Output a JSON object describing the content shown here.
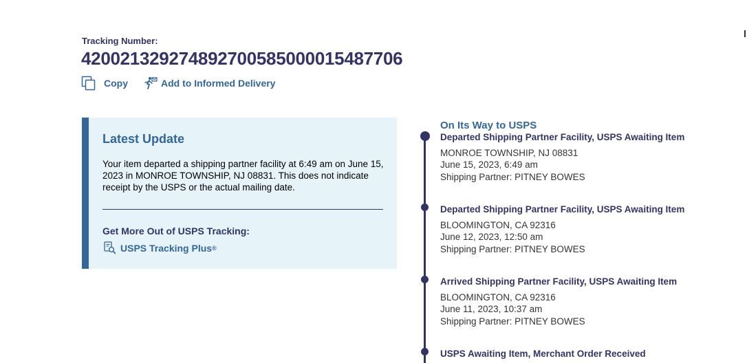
{
  "tracking": {
    "label": "Tracking Number:",
    "number": "420021329274892700585000015487706"
  },
  "actions": {
    "copy_label": "Copy",
    "informed_delivery_label": "Add to Informed Delivery"
  },
  "latest_update": {
    "title": "Latest Update",
    "text": "Your item departed a shipping partner facility at 6:49 am on June 15, 2023 in MONROE TOWNSHIP, NJ 08831. This does not indicate receipt by the USPS or the actual mailing date.",
    "more_title": "Get More Out of USPS Tracking:",
    "plus_label": "USPS Tracking Plus",
    "plus_mark": "®"
  },
  "timeline": {
    "status": "On Its Way to USPS",
    "events": [
      {
        "title": "Departed Shipping Partner Facility, USPS Awaiting Item",
        "location": "MONROE TOWNSHIP, NJ 08831",
        "datetime": "June 15, 2023, 6:49 am",
        "partner": "Shipping Partner: PITNEY BOWES"
      },
      {
        "title": "Departed Shipping Partner Facility, USPS Awaiting Item",
        "location": "BLOOMINGTON, CA 92316",
        "datetime": "June 12, 2023, 12:50 am",
        "partner": "Shipping Partner: PITNEY BOWES"
      },
      {
        "title": "Arrived Shipping Partner Facility, USPS Awaiting Item",
        "location": "BLOOMINGTON, CA 92316",
        "datetime": "June 11, 2023, 10:37 am",
        "partner": "Shipping Partner: PITNEY BOWES"
      },
      {
        "title": "USPS Awaiting Item, Merchant Order Received"
      }
    ]
  },
  "icons": {
    "copy": "copy-icon",
    "informed_delivery": "informed-delivery-icon",
    "tracking_plus": "tracking-plus-icon"
  },
  "colors": {
    "navy": "#333366",
    "link_blue": "#336699",
    "update_bg": "#e6f4f9"
  }
}
